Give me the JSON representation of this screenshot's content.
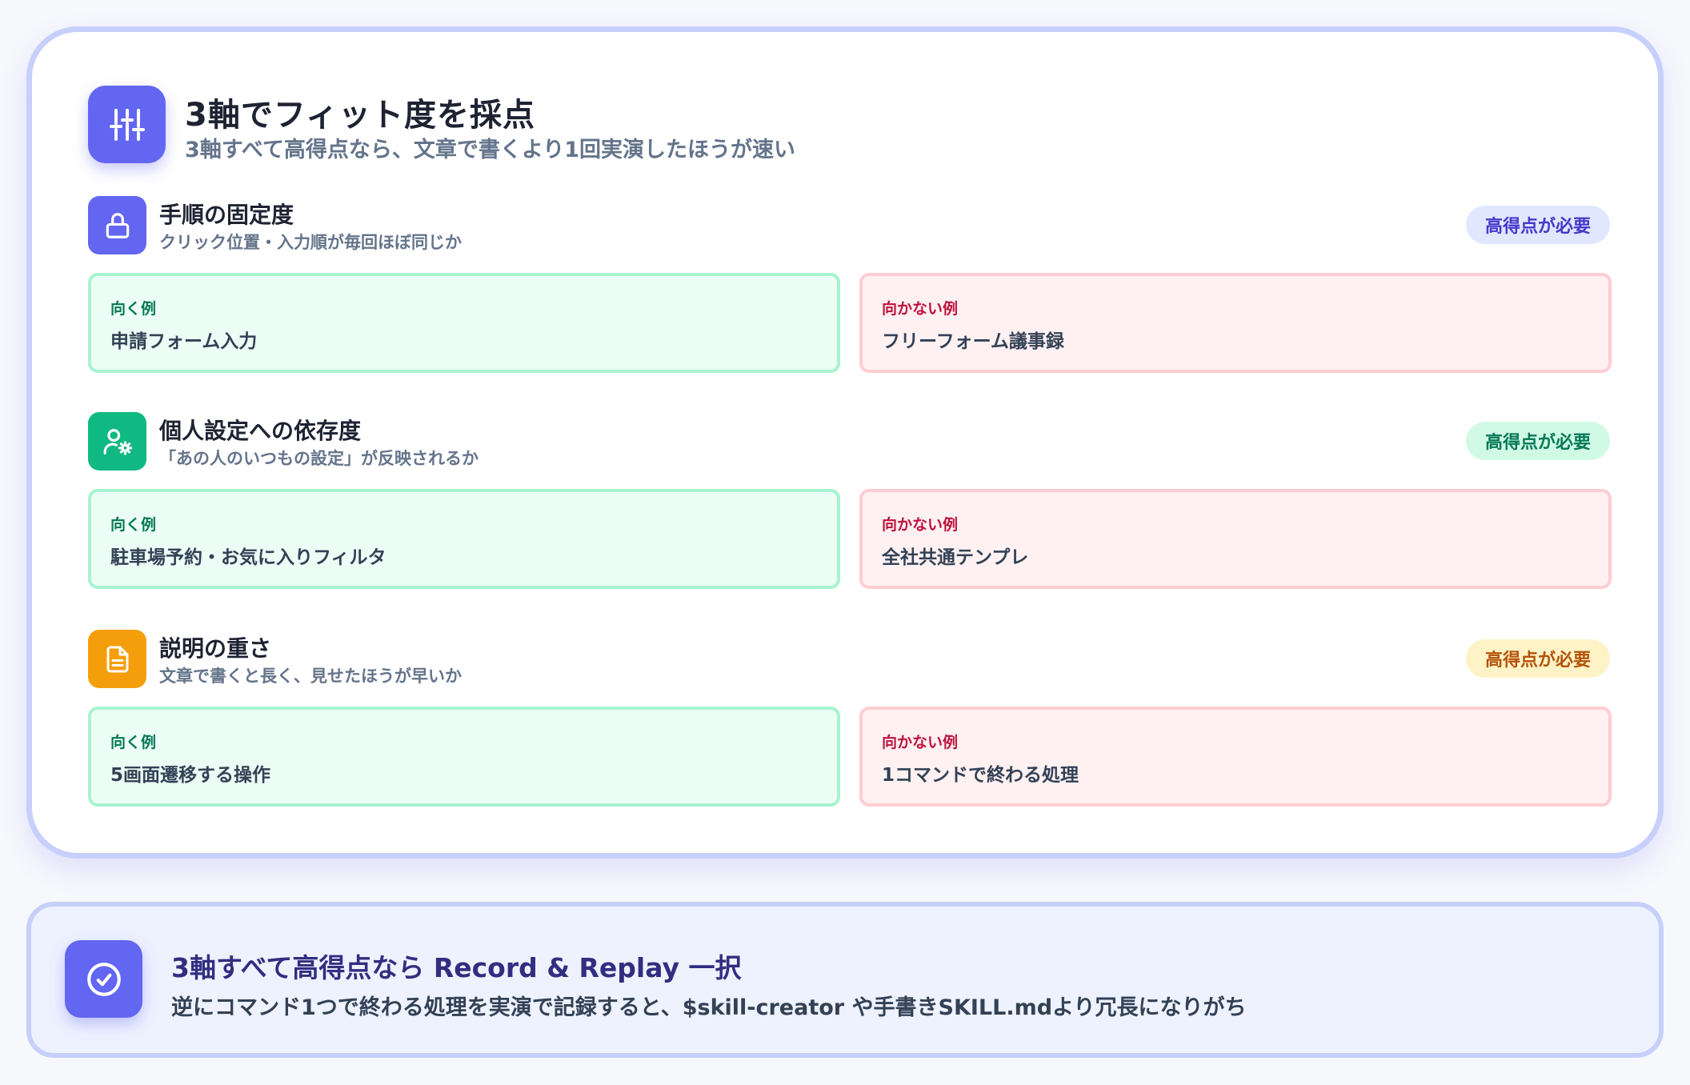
{
  "header": {
    "icon": "sliders-icon",
    "title": "3軸でフィット度を採点",
    "subtitle": "3軸すべて高得点なら、文章で書くより1回実演したほうが速い"
  },
  "sections": [
    {
      "icon": "lock-icon",
      "icon_color": "#6366f1",
      "title": "手順の固定度",
      "description": "クリック位置・入力順が毎回ほぼ同じか",
      "badge": "高得点が必要",
      "good_label": "向く例",
      "good_example": "申請フォーム入力",
      "bad_label": "向かない例",
      "bad_example": "フリーフォーム議事録"
    },
    {
      "icon": "user-settings-icon",
      "icon_color": "#10b981",
      "title": "個人設定への依存度",
      "description": "「あの人のいつもの設定」が反映されるか",
      "badge": "高得点が必要",
      "good_label": "向く例",
      "good_example": "駐車場予約・お気に入りフィルタ",
      "bad_label": "向かない例",
      "bad_example": "全社共通テンプレ"
    },
    {
      "icon": "document-icon",
      "icon_color": "#f59e0b",
      "title": "説明の重さ",
      "description": "文章で書くと長く、見せたほうが早いか",
      "badge": "高得点が必要",
      "good_label": "向く例",
      "good_example": "5画面遷移する操作",
      "bad_label": "向かない例",
      "bad_example": "1コマンドで終わる処理"
    }
  ],
  "footer": {
    "icon": "check-circle-icon",
    "title": "3軸すべて高得点なら Record & Replay 一択",
    "text": "逆にコマンド1つで終わる処理を実演で記録すると、$skill-creator や手書きSKILL.mdより冗長になりがち"
  },
  "colors": {
    "accent": "#6366f1",
    "good_bg": "#ecfdf5",
    "bad_bg": "#fff1f2"
  }
}
